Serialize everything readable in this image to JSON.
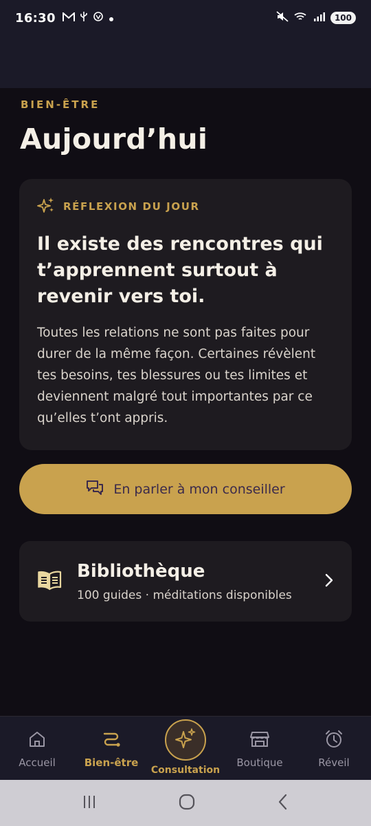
{
  "status_bar": {
    "time": "16:30",
    "battery": "100",
    "icons": [
      "gmail-icon",
      "usb-icon",
      "chatgpt-icon",
      "dot-icon",
      "mute-icon",
      "wifi-icon",
      "signal-icon"
    ]
  },
  "section_label": "BIEN-ÊTRE",
  "page_title": "Aujourd’hui",
  "reflection_card": {
    "kicker_icon": "sparkle-icon",
    "kicker": "RÉFLEXION DU JOUR",
    "quote": "Il existe des rencontres qui t’apprennent surtout à revenir vers toi.",
    "body": "Toutes les relations ne sont pas faites pour durer de la même façon. Certaines révèlent tes besoins, tes blessures ou tes limites et deviennent malgré tout importantes par ce qu’elles t’ont appris."
  },
  "advisor_button": {
    "icon": "chat-icon",
    "label": "En parler à mon conseiller"
  },
  "library_card": {
    "icon": "book-icon",
    "title": "Bibliothèque",
    "subtitle": "100 guides · méditations disponibles"
  },
  "bottom_nav": {
    "items": [
      {
        "label": "Accueil",
        "icon": "home-icon",
        "active": false
      },
      {
        "label": "Bien-être",
        "icon": "path-icon",
        "active": true
      },
      {
        "label": "Consultation",
        "icon": "sparkle-icon",
        "active": false
      },
      {
        "label": "Boutique",
        "icon": "store-icon",
        "active": false
      },
      {
        "label": "Réveil",
        "icon": "alarm-icon",
        "active": false
      }
    ]
  },
  "colors": {
    "accent": "#c9a24e",
    "background": "#100d14",
    "card": "#1e1b20",
    "nav": "#1b1a28"
  }
}
